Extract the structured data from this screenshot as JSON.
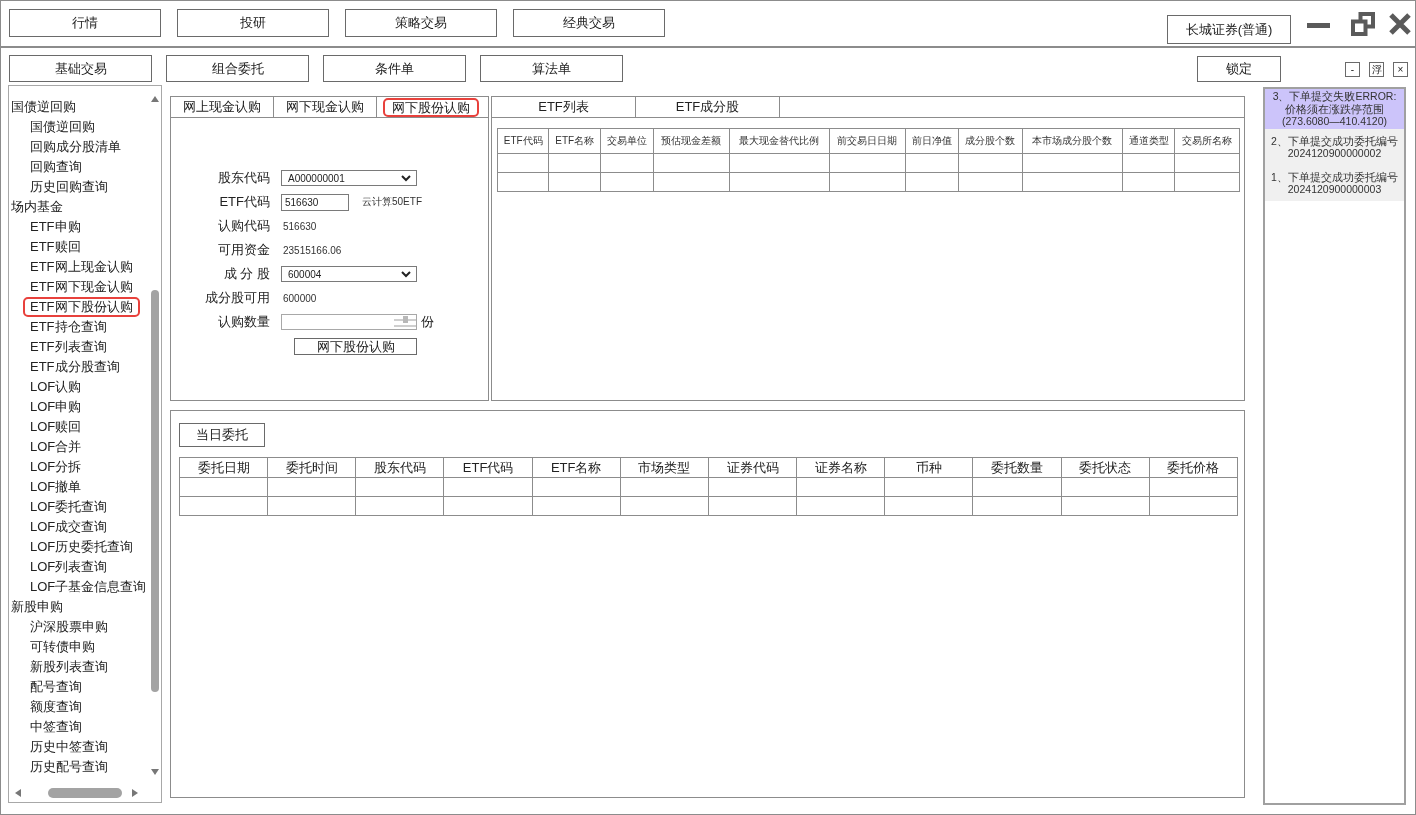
{
  "top_nav": [
    "行情",
    "投研",
    "策略交易",
    "经典交易"
  ],
  "account": "长城证券(普通)",
  "sub_nav": [
    "基础交易",
    "组合委托",
    "条件单",
    "算法单"
  ],
  "lock_button": "锁定",
  "panel_buttons": [
    "-",
    "浮",
    "×"
  ],
  "sidebar": {
    "items": [
      {
        "label": "国债逆回购",
        "selected": false,
        "children": [
          {
            "label": "国债逆回购",
            "selected": false
          },
          {
            "label": "回购成分股清单",
            "selected": false
          },
          {
            "label": "回购查询",
            "selected": false
          },
          {
            "label": "历史回购查询",
            "selected": false
          }
        ]
      },
      {
        "label": "场内基金",
        "selected": false,
        "children": [
          {
            "label": "ETF申购",
            "selected": false
          },
          {
            "label": "ETF赎回",
            "selected": false
          },
          {
            "label": "ETF网上现金认购",
            "selected": false
          },
          {
            "label": "ETF网下现金认购",
            "selected": false
          },
          {
            "label": "ETF网下股份认购",
            "selected": true
          },
          {
            "label": "ETF持仓查询",
            "selected": false
          },
          {
            "label": "ETF列表查询",
            "selected": false
          },
          {
            "label": "ETF成分股查询",
            "selected": false
          },
          {
            "label": "LOF认购",
            "selected": false
          },
          {
            "label": "LOF申购",
            "selected": false
          },
          {
            "label": "LOF赎回",
            "selected": false
          },
          {
            "label": "LOF合并",
            "selected": false
          },
          {
            "label": "LOF分拆",
            "selected": false
          },
          {
            "label": "LOF撤单",
            "selected": false
          },
          {
            "label": "LOF委托查询",
            "selected": false
          },
          {
            "label": "LOF成交查询",
            "selected": false
          },
          {
            "label": "LOF历史委托查询",
            "selected": false
          },
          {
            "label": "LOF列表查询",
            "selected": false
          },
          {
            "label": "LOF子基金信息查询",
            "selected": false
          }
        ]
      },
      {
        "label": "新股申购",
        "selected": false,
        "children": [
          {
            "label": "沪深股票申购",
            "selected": false
          },
          {
            "label": "可转债申购",
            "selected": false
          },
          {
            "label": "新股列表查询",
            "selected": false
          },
          {
            "label": "配号查询",
            "selected": false
          },
          {
            "label": "额度查询",
            "selected": false
          },
          {
            "label": "中签查询",
            "selected": false
          },
          {
            "label": "历史中签查询",
            "selected": false
          },
          {
            "label": "历史配号查询",
            "selected": false
          }
        ]
      }
    ]
  },
  "order_form": {
    "tabs": [
      {
        "label": "网上现金认购",
        "selected": false
      },
      {
        "label": "网下现金认购",
        "selected": false
      },
      {
        "label": "网下股份认购",
        "selected": true
      }
    ],
    "fields": [
      {
        "kind": "select",
        "label": "股东代码",
        "value": "A000000001"
      },
      {
        "kind": "input",
        "label": "ETF代码",
        "value": "516630",
        "note": "云计算50ETF"
      },
      {
        "kind": "text",
        "label": "认购代码",
        "value": "516630"
      },
      {
        "kind": "text",
        "label": "可用资金",
        "value": "23515166.06"
      },
      {
        "kind": "select",
        "label": "成 分 股",
        "value": "600004"
      },
      {
        "kind": "text",
        "label": "成分股可用",
        "value": "600000"
      },
      {
        "kind": "spinner",
        "label": "认购数量",
        "unit": "份"
      }
    ],
    "submit": "网下股份认购"
  },
  "etf_panel": {
    "tabs": [
      "ETF列表",
      "ETF成分股"
    ],
    "table": {
      "columns": [
        "ETF代码",
        "ETF名称",
        "交易单位",
        "预估现金差额",
        "最大现金替代比例",
        "前交易日日期",
        "前日净值",
        "成分股个数",
        "本市场成分股个数",
        "通道类型",
        "交易所名称"
      ]
    }
  },
  "orders_panel": {
    "tab": "当日委托",
    "table": {
      "columns": [
        "委托日期",
        "委托时间",
        "股东代码",
        "ETF代码",
        "ETF名称",
        "市场类型",
        "证券代码",
        "证券名称",
        "币种",
        "委托数量",
        "委托状态",
        "委托价格"
      ]
    }
  },
  "messages": [
    {
      "kind": "error",
      "text": "3、下单提交失败ERROR:价格须在涨跌停范围(273.6080—410.4120)"
    },
    {
      "kind": "success",
      "text": "2、下单提交成功委托编号",
      "order_no": "2024120900000002"
    },
    {
      "kind": "success",
      "text": "1、下单提交成功委托编号",
      "order_no": "2024120900000003"
    }
  ]
}
